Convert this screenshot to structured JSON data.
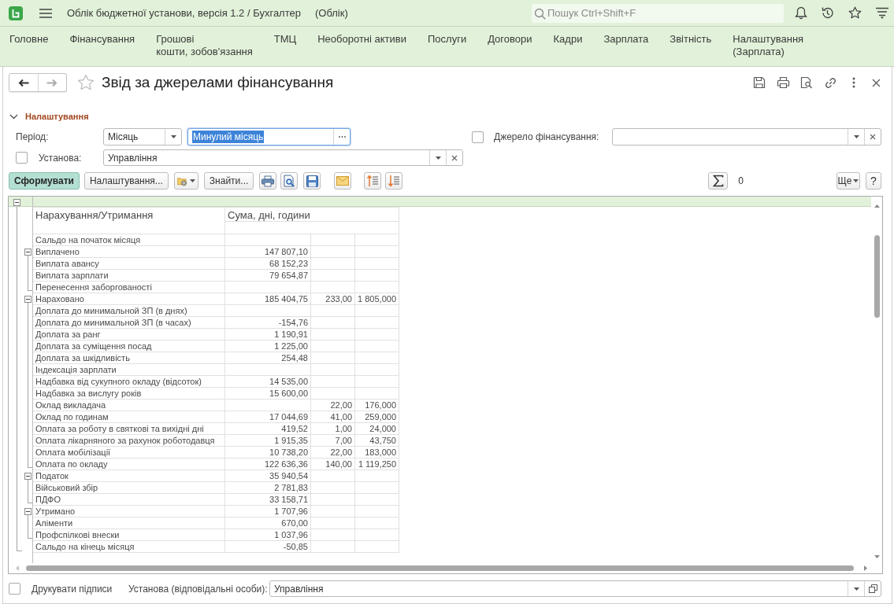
{
  "top_bar": {
    "title": "Облік бюджетної установи, версія 1.2 / Бухгалтер",
    "mode": "(Облік)",
    "search": {
      "placeholder": "Пошук Ctrl+Shift+F"
    }
  },
  "sections": [
    {
      "label": "Головне"
    },
    {
      "label": "Фінансування"
    },
    {
      "label": "Грошові\nкошти, зобов'язання"
    },
    {
      "label": "ТМЦ"
    },
    {
      "label": "Необоротні активи"
    },
    {
      "label": "Послуги"
    },
    {
      "label": "Договори"
    },
    {
      "label": "Кадри"
    },
    {
      "label": "Зарплата"
    },
    {
      "label": "Звітність"
    },
    {
      "label": "Налаштування\n(Зарплата)"
    }
  ],
  "form": {
    "navigation": {
      "back_enabled": true,
      "forward_enabled": false
    },
    "favorite": false,
    "title": "Звід за джерелами фінансування",
    "settings_group": {
      "label": "Налаштування",
      "expanded": true
    },
    "period": {
      "label": "Період:",
      "type": "Місяць",
      "value": "Минулий місяць",
      "focused": true
    },
    "funding_source": {
      "label": "Джерело фінансування:",
      "checked": false
    },
    "institution": {
      "label": "Установа:",
      "checked": false,
      "value": "Управління"
    },
    "toolbar": {
      "buttons": [
        {
          "label": "Сформувати",
          "default": true
        },
        {
          "label": "Налаштування...",
          "default": false
        },
        {
          "label": "Знайти...",
          "default": false
        }
      ],
      "sum": "0",
      "more": "Ще",
      "help": "?"
    }
  },
  "report": {
    "expanded": true,
    "columns": [
      "Нарахування/Утримання",
      "Сума, дні, години"
    ],
    "rows": [
      {
        "name": "Сальдо на початок місяця"
      },
      {
        "name": "Виплачено",
        "sum": "147 807,10",
        "expanded": true,
        "children": [
          {
            "name": "Виплата авансу",
            "sum": "68 152,23"
          },
          {
            "name": "Виплата зарплати",
            "sum": "79 654,87"
          },
          {
            "name": "Перенесення заборгованості"
          }
        ]
      },
      {
        "name": "Нараховано",
        "sum": "185 404,75",
        "days": "233,00",
        "hours": "1 805,000",
        "expanded": true,
        "children": [
          {
            "name": "Доплата до минимальной ЗП (в днях)"
          },
          {
            "name": "Доплата до минимальной ЗП (в часах)",
            "sum": "-154,76"
          },
          {
            "name": "Доплата за ранг",
            "sum": "1 190,91"
          },
          {
            "name": "Доплата за суміщення посад",
            "sum": "1 225,00"
          },
          {
            "name": "Доплата за шкідливість",
            "sum": "254,48"
          },
          {
            "name": "Індексація зарплати"
          },
          {
            "name": "Надбавка від сукупного окладу (відсоток)",
            "sum": "14 535,00"
          },
          {
            "name": "Надбавка за вислугу років",
            "sum": "15 600,00"
          },
          {
            "name": "Оклад викладача",
            "days": "22,00",
            "hours": "176,000"
          },
          {
            "name": "Оклад по годинам",
            "sum": "17 044,69",
            "days": "41,00",
            "hours": "259,000"
          },
          {
            "name": "Оплата за роботу в святкові та вихідні дні",
            "sum": "419,52",
            "days": "1,00",
            "hours": "24,000"
          },
          {
            "name": "Оплата лікарняного за рахунок роботодавця",
            "sum": "1 915,35",
            "days": "7,00",
            "hours": "43,750"
          },
          {
            "name": "Оплата мобілізації",
            "sum": "10 738,20",
            "days": "22,00",
            "hours": "183,000"
          },
          {
            "name": "Оплата по окладу",
            "sum": "122 636,36",
            "days": "140,00",
            "hours": "1 119,250"
          }
        ]
      },
      {
        "name": "Податок",
        "sum": "35 940,54",
        "expanded": true,
        "children": [
          {
            "name": "Військовий збір",
            "sum": "2 781,83"
          },
          {
            "name": "ПДФО",
            "sum": "33 158,71"
          }
        ]
      },
      {
        "name": "Утримано",
        "sum": "1 707,96",
        "expanded": true,
        "children": [
          {
            "name": "Аліменти",
            "sum": "670,00"
          },
          {
            "name": "Профспілкові внески",
            "sum": "1 037,96"
          }
        ]
      },
      {
        "name": "Сальдо на кінець місяця",
        "sum": "-50,85"
      }
    ]
  },
  "footer": {
    "print_signatures": {
      "label": "Друкувати підписи",
      "checked": false
    },
    "responsible": {
      "label": "Установа (відповідальні особи):",
      "value": "Управління"
    }
  }
}
